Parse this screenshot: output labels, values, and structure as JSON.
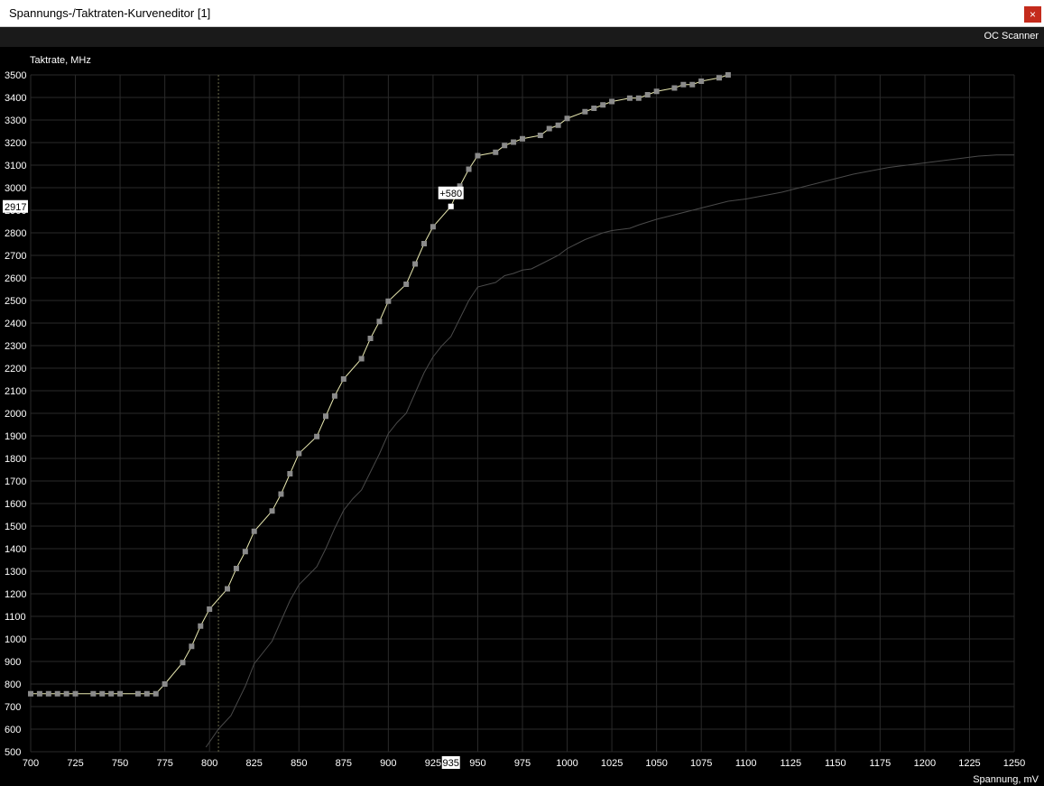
{
  "window": {
    "title": "Spannungs-/Taktraten-Kurveneditor [1]",
    "close_label": "×"
  },
  "toolbar": {
    "oc_scanner_label": "OC Scanner"
  },
  "colors": {
    "background": "#000000",
    "grid": "#2a2a2a",
    "axis_text": "#ffffff",
    "curve_active": "#e8e8b0",
    "curve_default": "#4a4a4a",
    "point": "#8a8a8a",
    "selected_point": "#ffffff"
  },
  "chart_data": {
    "type": "line",
    "ylabel": "Taktrate, MHz",
    "xlabel": "Spannung, mV",
    "xlim": [
      700,
      1250
    ],
    "ylim": [
      500,
      3500
    ],
    "x_ticks": [
      700,
      725,
      750,
      775,
      800,
      825,
      850,
      875,
      900,
      925,
      950,
      975,
      1000,
      1025,
      1050,
      1075,
      1100,
      1125,
      1150,
      1175,
      1200,
      1225,
      1250
    ],
    "y_ticks": [
      500,
      600,
      700,
      800,
      900,
      1000,
      1100,
      1200,
      1300,
      1400,
      1500,
      1600,
      1700,
      1800,
      1900,
      2000,
      2100,
      2200,
      2300,
      2400,
      2500,
      2600,
      2700,
      2800,
      2900,
      3000,
      3100,
      3200,
      3300,
      3400,
      3500
    ],
    "vertical_marker_x": 805,
    "selected_point": {
      "x": 935,
      "y": 2917,
      "x_label": "935",
      "y_label": "2917",
      "offset_label": "+580"
    },
    "series": [
      {
        "key": "active",
        "show_points": true,
        "x": [
          700,
          705,
          710,
          715,
          720,
          725,
          735,
          740,
          745,
          750,
          760,
          765,
          770,
          775,
          785,
          790,
          795,
          800,
          810,
          815,
          820,
          825,
          835,
          840,
          845,
          850,
          860,
          865,
          870,
          875,
          885,
          890,
          895,
          900,
          910,
          915,
          920,
          925,
          935,
          940,
          945,
          950,
          960,
          965,
          970,
          975,
          985,
          990,
          995,
          1000,
          1010,
          1015,
          1020,
          1025,
          1035,
          1040,
          1045,
          1050,
          1060,
          1065,
          1070,
          1075,
          1085,
          1090
        ],
        "y": [
          757,
          757,
          757,
          757,
          757,
          757,
          757,
          757,
          757,
          757,
          757,
          757,
          757,
          800,
          895,
          967,
          1057,
          1132,
          1222,
          1312,
          1387,
          1477,
          1567,
          1642,
          1732,
          1822,
          1897,
          1987,
          2077,
          2152,
          2242,
          2332,
          2407,
          2497,
          2572,
          2662,
          2752,
          2827,
          2917,
          3007,
          3082,
          3142,
          3157,
          3187,
          3202,
          3217,
          3232,
          3262,
          3277,
          3307,
          3337,
          3352,
          3367,
          3382,
          3397,
          3397,
          3412,
          3427,
          3442,
          3457,
          3457,
          3472,
          3487,
          3500
        ]
      },
      {
        "key": "default",
        "show_points": false,
        "x": [
          798,
          805,
          812,
          820,
          825,
          830,
          835,
          840,
          845,
          850,
          855,
          860,
          865,
          870,
          875,
          880,
          885,
          890,
          895,
          900,
          905,
          910,
          915,
          920,
          925,
          930,
          935,
          940,
          945,
          950,
          955,
          960,
          965,
          970,
          975,
          980,
          985,
          990,
          995,
          1000,
          1005,
          1010,
          1020,
          1025,
          1030,
          1035,
          1040,
          1050,
          1060,
          1070,
          1080,
          1090,
          1100,
          1110,
          1120,
          1130,
          1140,
          1150,
          1160,
          1170,
          1180,
          1190,
          1200,
          1210,
          1220,
          1230,
          1240,
          1250
        ],
        "y": [
          520,
          600,
          660,
          790,
          890,
          940,
          990,
          1080,
          1170,
          1240,
          1280,
          1320,
          1400,
          1490,
          1570,
          1620,
          1660,
          1740,
          1820,
          1910,
          1960,
          2000,
          2090,
          2180,
          2250,
          2300,
          2340,
          2420,
          2500,
          2560,
          2570,
          2580,
          2610,
          2620,
          2635,
          2640,
          2660,
          2680,
          2700,
          2730,
          2750,
          2770,
          2800,
          2810,
          2815,
          2820,
          2835,
          2860,
          2880,
          2900,
          2920,
          2940,
          2950,
          2965,
          2980,
          3000,
          3020,
          3040,
          3060,
          3075,
          3090,
          3100,
          3110,
          3120,
          3130,
          3140,
          3145,
          3145
        ]
      }
    ]
  }
}
